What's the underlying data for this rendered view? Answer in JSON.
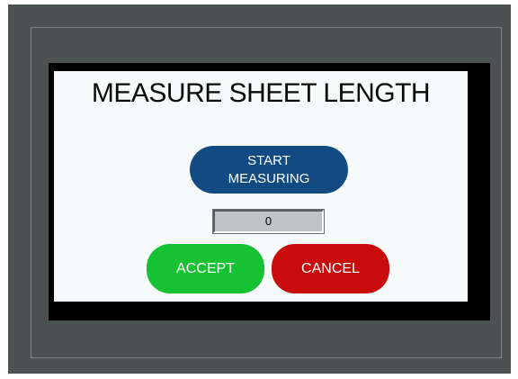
{
  "screen": {
    "title": "MEASURE SHEET LENGTH",
    "start_button": {
      "line1": "START",
      "line2": "MEASURING"
    },
    "measurement_value": "0",
    "accept_label": "ACCEPT",
    "cancel_label": "CANCEL"
  },
  "colors": {
    "device_body": "#4a5352",
    "screen_background": "#f6fafa",
    "start_button": "#114b82",
    "accept_button": "#16c233",
    "cancel_button": "#c80c0c",
    "value_field": "#bfc4c6"
  }
}
